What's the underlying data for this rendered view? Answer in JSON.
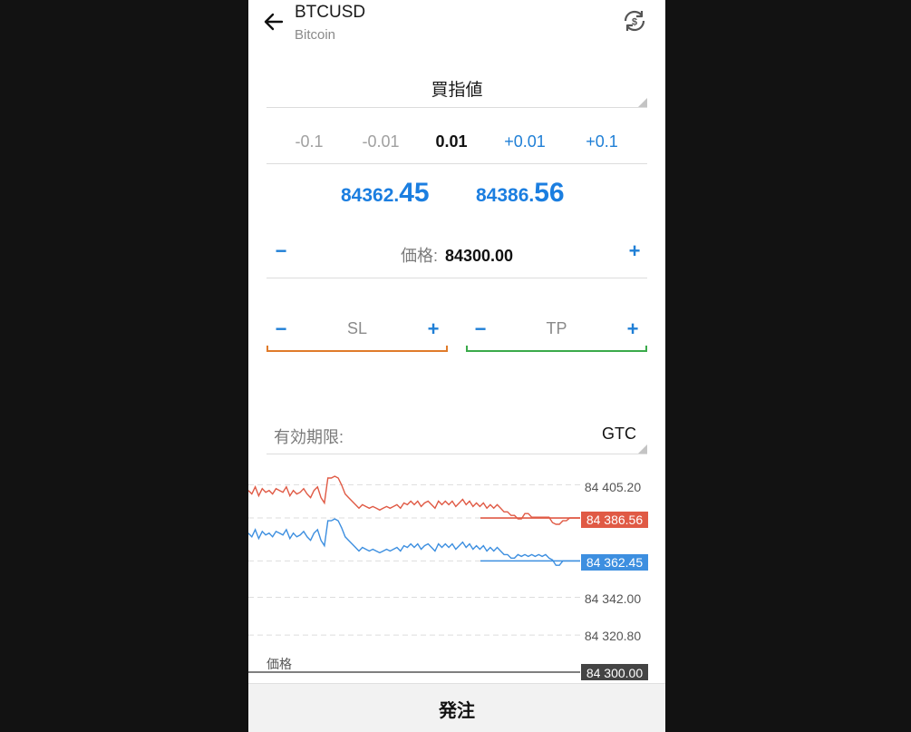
{
  "header": {
    "symbol": "BTCUSD",
    "description": "Bitcoin",
    "back_icon": "arrow-left-icon",
    "sync_icon": "currency-exchange-icon"
  },
  "order_type": {
    "label": "買指値"
  },
  "volume": {
    "options": [
      "-0.1",
      "-0.01",
      "0.01",
      "+0.01",
      "+0.1"
    ],
    "current": "0.01"
  },
  "quotes": {
    "bid": {
      "small": "84362.",
      "large": "45"
    },
    "ask": {
      "small": "84386.",
      "large": "56"
    }
  },
  "price": {
    "label": "価格:",
    "value": "84300.00",
    "minus": "−",
    "plus": "+"
  },
  "sl": {
    "label": "SL",
    "minus": "−",
    "plus": "+",
    "color": "#e07b2a"
  },
  "tp": {
    "label": "TP",
    "minus": "−",
    "plus": "+",
    "color": "#3aaa4a"
  },
  "expiration": {
    "label": "有効期限:",
    "value": "GTC"
  },
  "chart": {
    "ticks": [
      "84 405.20",
      "84 342.00",
      "84 320.80"
    ],
    "ask_tag": "84 386.56",
    "bid_tag": "84 362.45",
    "price_tag": "84 300.00",
    "price_line_label": "価格",
    "colors": {
      "ask": "#e05a45",
      "bid": "#3d8fe0",
      "price": "#555555"
    }
  },
  "chart_data": {
    "type": "line",
    "ylim": [
      84300.0,
      84410.0
    ],
    "yticks": [
      84405.2,
      84342.0,
      84320.8
    ],
    "series": [
      {
        "values": [
          84402,
          84400,
          84404,
          84399,
          84403,
          84401,
          84402,
          84400,
          84403,
          84402,
          84401,
          84404,
          84399,
          84402,
          84400,
          84401,
          84403,
          84400,
          84398,
          84402,
          84404,
          84398,
          84395,
          84409,
          84409,
          84410,
          84409,
          84405,
          84400,
          84398,
          84396,
          84394,
          84392,
          84394,
          84393,
          84392,
          84393,
          84392,
          84391,
          84392,
          84393,
          84392,
          84393,
          84394,
          84392,
          84395,
          84394,
          84396,
          84394,
          84396,
          84393,
          84395,
          84396,
          84394,
          84392,
          84396,
          84394,
          84396,
          84394,
          84396,
          84393,
          84395,
          84397,
          84394,
          84396,
          84393,
          84395,
          84393,
          84395,
          84392,
          84394,
          84392,
          84394,
          84392,
          84390,
          84390,
          84388,
          84388,
          84386,
          84386,
          84389,
          84389,
          84387,
          84387,
          84387,
          84387,
          84387,
          84387,
          84384,
          84383,
          84383,
          84385,
          84385,
          84386.56,
          84386.56,
          84386.56,
          84386.56
        ]
      },
      {
        "values": [
          84378,
          84376,
          84380,
          84375,
          84379,
          84377,
          84378,
          84376,
          84379,
          84378,
          84377,
          84380,
          84375,
          84378,
          84376,
          84377,
          84379,
          84376,
          84374,
          84378,
          84380,
          84374,
          84371,
          84385,
          84385,
          84386,
          84385,
          84381,
          84376,
          84374,
          84372,
          84370,
          84368,
          84370,
          84369,
          84368,
          84369,
          84368,
          84367,
          84368,
          84369,
          84368,
          84369,
          84370,
          84368,
          84371,
          84370,
          84372,
          84370,
          84372,
          84369,
          84371,
          84372,
          84370,
          84368,
          84372,
          84370,
          84372,
          84370,
          84372,
          84369,
          84371,
          84373,
          84370,
          84372,
          84369,
          84371,
          84369,
          84371,
          84368,
          84370,
          84368,
          84370,
          84368,
          84366,
          84366,
          84364,
          84364,
          84366,
          84365,
          84366,
          84365,
          84366,
          84365,
          84366,
          84365,
          84366,
          84364,
          84363,
          84360,
          84360,
          84362.45,
          84362.45,
          84362.45,
          84362.45,
          84362.45,
          84362.45
        ]
      }
    ],
    "hlines": {
      "ask": 84386.56,
      "bid": 84362.45,
      "price": 84300.0
    }
  },
  "footer": {
    "button_label": "発注"
  }
}
